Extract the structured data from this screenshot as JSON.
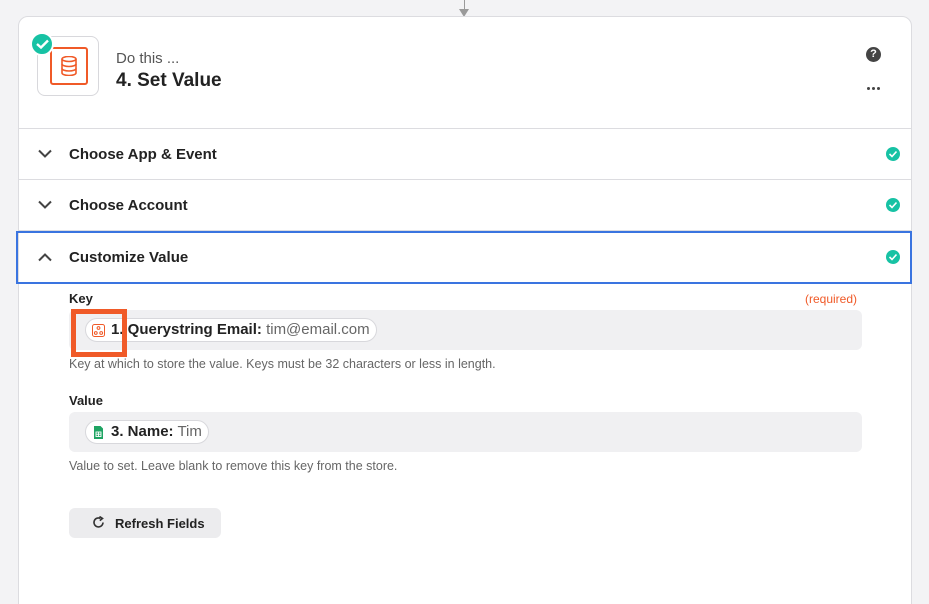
{
  "step": {
    "subtitle": "Do this ...",
    "title": "4. Set Value",
    "help_symbol": "?"
  },
  "sections": [
    {
      "label": "Choose App & Event",
      "expanded": false,
      "complete": true
    },
    {
      "label": "Choose Account",
      "expanded": false,
      "complete": true
    },
    {
      "label": "Customize Value",
      "expanded": true,
      "complete": true
    }
  ],
  "fields": {
    "key": {
      "label": "Key",
      "required_label": "(required)",
      "chip_key": "1. Querystring Email:",
      "chip_value": "tim@email.com",
      "chip_icon": "webhook-icon",
      "help": "Key at which to store the value. Keys must be 32 characters or less in length."
    },
    "value": {
      "label": "Value",
      "chip_key": "3. Name:",
      "chip_value": "Tim",
      "chip_icon": "google-sheets-icon",
      "help": "Value to set. Leave blank to remove this key from the store."
    }
  },
  "refresh_button": {
    "label": "Refresh Fields"
  },
  "colors": {
    "accent_orange": "#f05a28",
    "success_teal": "#17c2a4",
    "focus_blue": "#3a74e0"
  }
}
